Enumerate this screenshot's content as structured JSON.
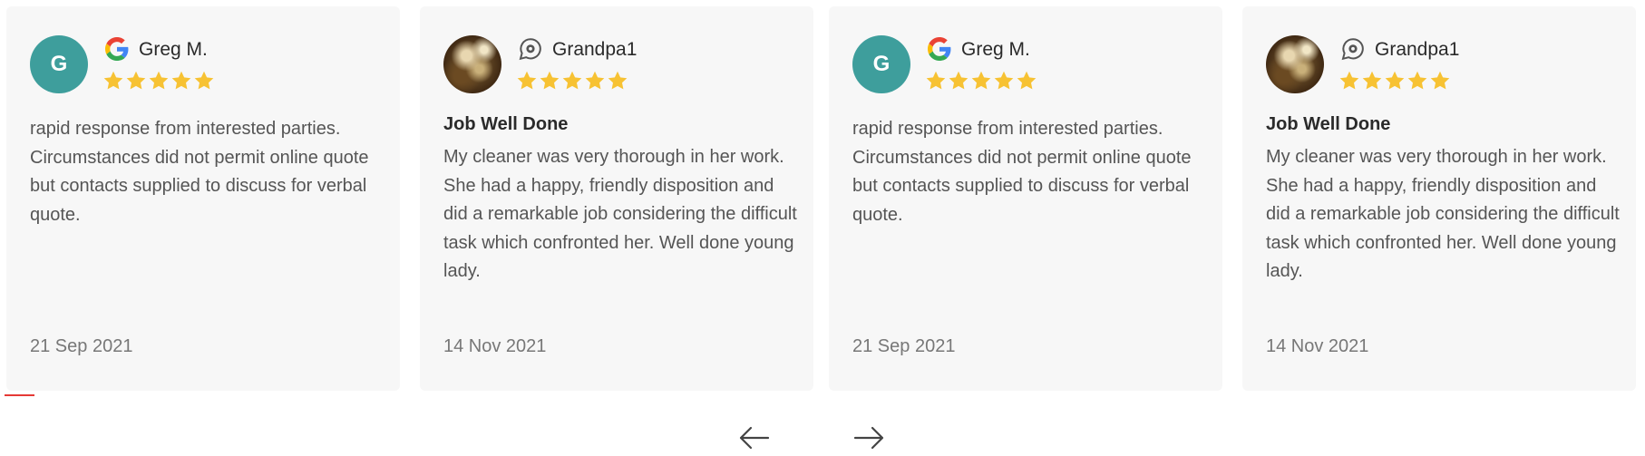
{
  "colors": {
    "card_background": "#f7f7f7",
    "avatar_teal": "#3e9e9c",
    "star_yellow": "#f7c233",
    "progress_red": "#e53935"
  },
  "reviews": [
    {
      "source_icon": "google-icon",
      "avatar_letter": "G",
      "reviewer": "Greg M.",
      "rating": 5,
      "title": "",
      "text": "rapid response from interested parties. Circumstances did not permit online quote but contacts supplied to discuss for verbal quote.",
      "date": "21 Sep 2021"
    },
    {
      "source_icon": "chat-bubble-icon",
      "avatar_letter": "",
      "reviewer": "Grandpa1",
      "rating": 5,
      "title": "Job Well Done",
      "text": "My cleaner was very thorough in her work. She had a happy, friendly disposition and did a remarkable job considering the difficult task which confronted her. Well done young lady.",
      "date": "14 Nov 2021"
    },
    {
      "source_icon": "google-icon",
      "avatar_letter": "G",
      "reviewer": "Greg M.",
      "rating": 5,
      "title": "",
      "text": "rapid response from interested parties. Circumstances did not permit online quote but contacts supplied to discuss for verbal quote.",
      "date": "21 Sep 2021"
    },
    {
      "source_icon": "chat-bubble-icon",
      "avatar_letter": "",
      "reviewer": "Grandpa1",
      "rating": 5,
      "title": "Job Well Done",
      "text": "My cleaner was very thorough in her work. She had a happy, friendly disposition and did a remarkable job considering the difficult task which confronted her. Well done young lady.",
      "date": "14 Nov 2021"
    }
  ],
  "navigation": {
    "prev_icon": "arrow-left-icon",
    "next_icon": "arrow-right-icon"
  }
}
